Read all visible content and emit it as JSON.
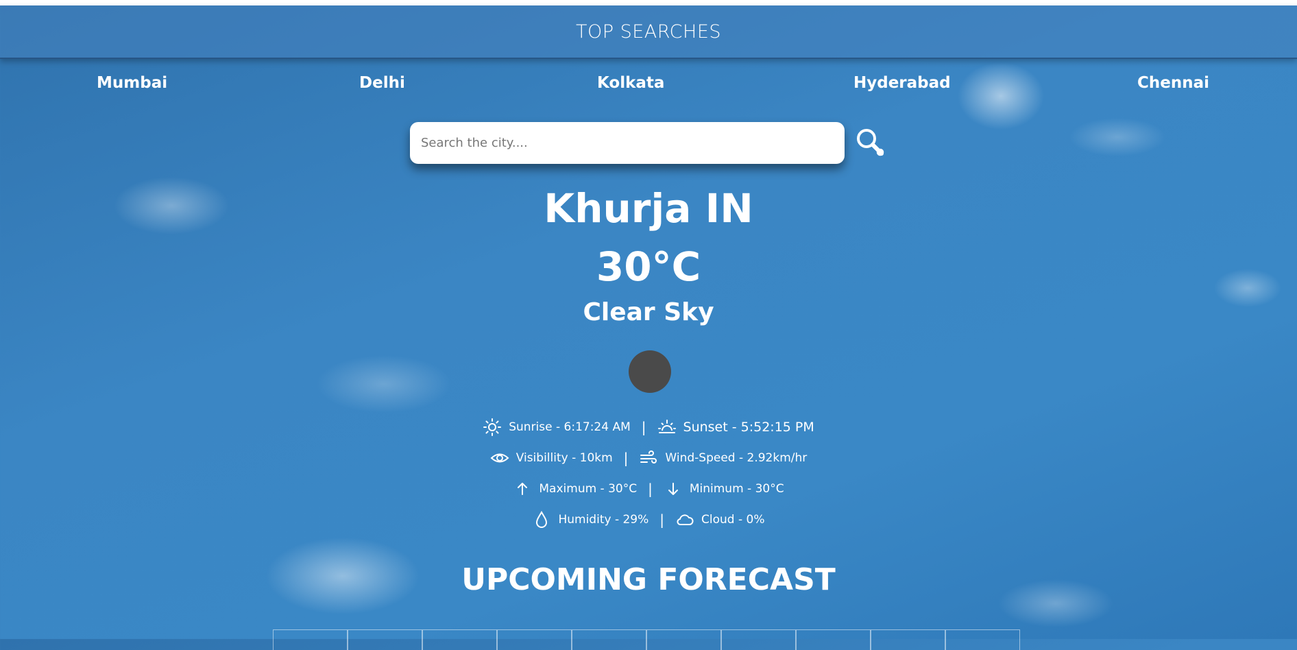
{
  "header": {
    "title": "TOP SEARCHES"
  },
  "top_cities": [
    "Mumbai",
    "Delhi",
    "Kolkata",
    "Hyderabad",
    "Chennai"
  ],
  "search": {
    "placeholder": "Search the city....",
    "value": ""
  },
  "current": {
    "city": "Khurja IN",
    "temperature": "30°C",
    "description": "Clear Sky"
  },
  "details": {
    "sunrise": "Sunrise - 6:17:24 AM",
    "sunset": "Sunset - 5:52:15 PM",
    "visibility": "Visibillity - 10km",
    "wind": "Wind-Speed - 2.92km/hr",
    "max": "Maximum - 30°C",
    "min": "Minimum - 30°C",
    "humidity": "Humidity - 29%",
    "cloud": "Cloud - 0%",
    "separator": "|"
  },
  "forecast": {
    "title": "UPCOMING FORECAST",
    "cell_count": 10
  },
  "icons": [
    "search-icon",
    "sun-icon",
    "sunset-icon",
    "eye-icon",
    "wind-icon",
    "arrow-up-icon",
    "arrow-down-icon",
    "droplet-icon",
    "cloud-icon"
  ]
}
